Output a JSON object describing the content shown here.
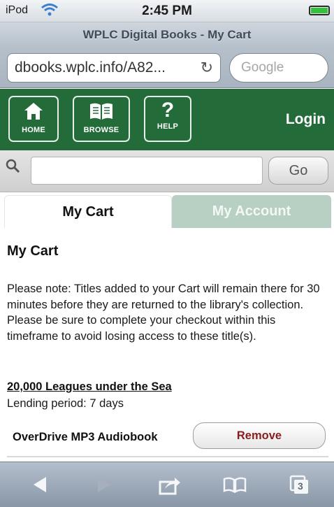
{
  "status_bar": {
    "carrier": "iPod",
    "time": "2:45 PM",
    "battery_level": 1.0,
    "battery_color": "#36c13a"
  },
  "browser": {
    "title": "WPLC Digital Books - My Cart",
    "url": "dbooks.wplc.info/A82...",
    "search_placeholder": "Google"
  },
  "site_nav": {
    "brand_color": "#246b3a",
    "buttons": [
      {
        "label": "HOME",
        "icon": "home-icon"
      },
      {
        "label": "BROWSE",
        "icon": "book-icon"
      },
      {
        "label": "HELP",
        "icon": "help-icon"
      }
    ],
    "login_label": "Login"
  },
  "search": {
    "value": "",
    "go_label": "Go"
  },
  "tabs": [
    {
      "label": "My Cart",
      "active": true
    },
    {
      "label": "My Account",
      "active": false
    }
  ],
  "cart": {
    "heading": "My Cart",
    "note": "Please note: Titles added to your Cart will remain there for 30 minutes before they are returned to the library's collection. Please be sure to complete your checkout within this timeframe to avoid losing access to these title(s).",
    "item": {
      "title": "20,000 Leagues under the Sea",
      "lending_period": "Lending period: 7 days",
      "format": "OverDrive MP3 Audiobook",
      "remove_label": "Remove"
    }
  },
  "toolbar": {
    "icons": [
      "back-arrow-icon",
      "forward-arrow-icon",
      "share-icon",
      "bookmarks-icon",
      "tabs-icon"
    ],
    "open_tabs_count": "3"
  }
}
